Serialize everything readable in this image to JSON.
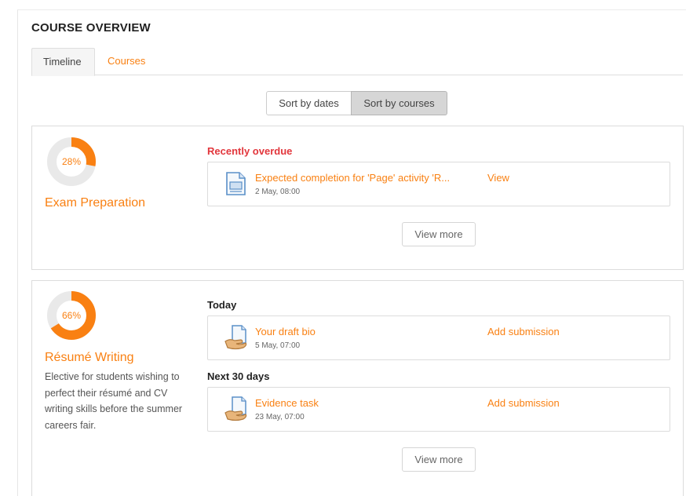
{
  "header": {
    "title": "COURSE OVERVIEW"
  },
  "tabs": [
    {
      "label": "Timeline",
      "active": true
    },
    {
      "label": "Courses",
      "active": false
    }
  ],
  "sort": {
    "by_dates": "Sort by dates",
    "by_courses": "Sort by courses",
    "selected": "by_courses"
  },
  "colors": {
    "accent": "#f98012",
    "overdue": "#e2363c",
    "track": "#e9e9e9"
  },
  "courses": [
    {
      "name": "Exam Preparation",
      "progress_label": "28%",
      "progress": 28,
      "description": "",
      "sections": [
        {
          "heading": "Recently overdue",
          "overdue": true,
          "events": [
            {
              "icon": "page-icon",
              "name": "Expected completion for 'Page' activity 'R...",
              "date": "2 May, 08:00",
              "action": "View"
            }
          ]
        }
      ],
      "view_more": "View more"
    },
    {
      "name": "Résumé Writing",
      "progress_label": "66%",
      "progress": 66,
      "description": "Elective for students wishing to perfect their résumé and CV writing skills before the summer careers fair.",
      "sections": [
        {
          "heading": "Today",
          "overdue": false,
          "events": [
            {
              "icon": "assignment-icon",
              "name": "Your draft bio",
              "date": "5 May, 07:00",
              "action": "Add submission"
            }
          ]
        },
        {
          "heading": "Next 30 days",
          "overdue": false,
          "events": [
            {
              "icon": "assignment-icon",
              "name": "Evidence task",
              "date": "23 May, 07:00",
              "action": "Add submission"
            }
          ]
        }
      ],
      "view_more": "View more"
    }
  ]
}
